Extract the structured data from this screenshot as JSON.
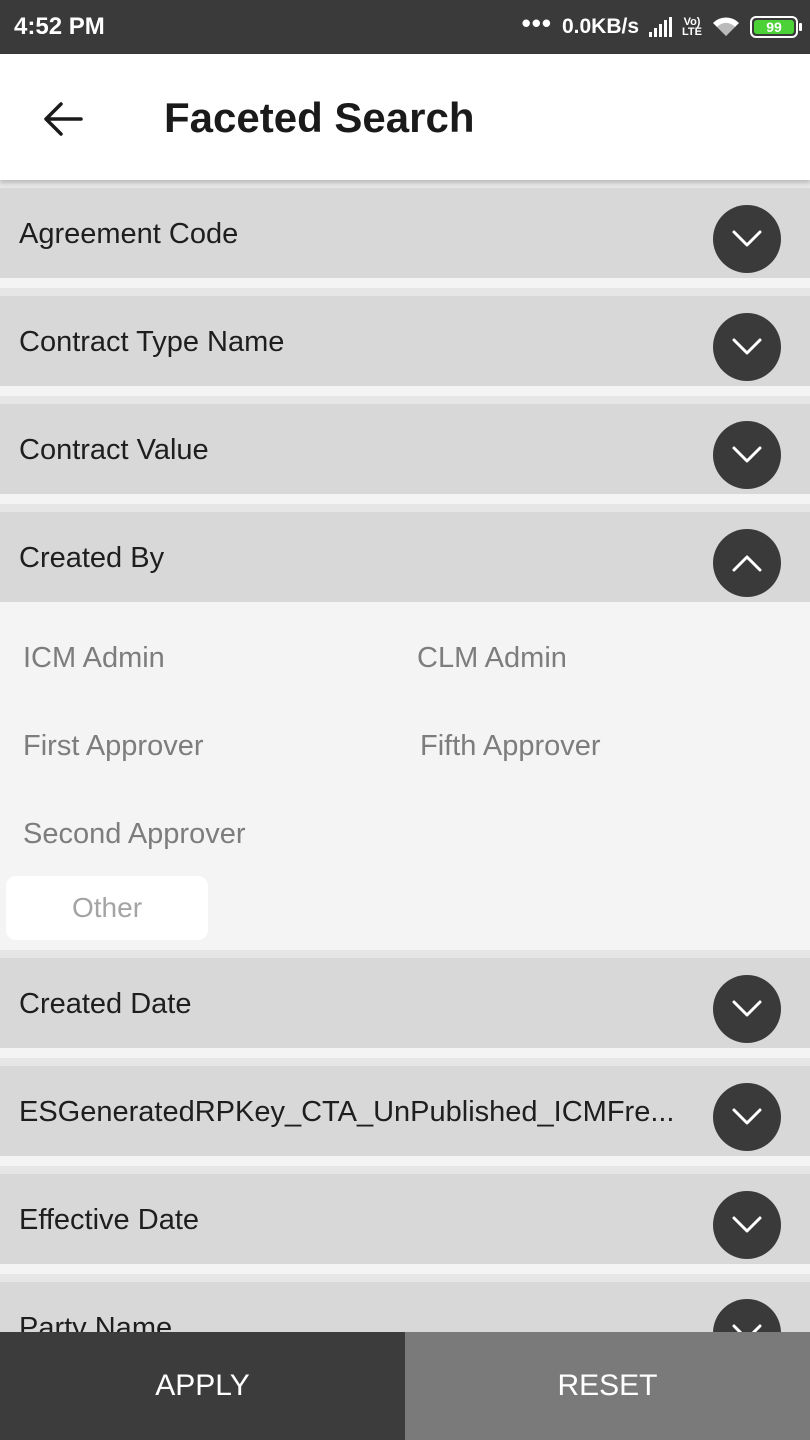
{
  "status_bar": {
    "time": "4:52 PM",
    "dots": "•••",
    "network_speed": "0.0KB/s",
    "volte_line1": "Vo)",
    "volte_line2": "LTE",
    "battery_level": "99",
    "battery_color": "#4cd137"
  },
  "header": {
    "title": "Faceted Search",
    "back_icon": "arrow-left-icon"
  },
  "facets": [
    {
      "label": "Agreement Code",
      "expanded": false
    },
    {
      "label": "Contract Type Name",
      "expanded": false
    },
    {
      "label": "Contract Value",
      "expanded": false
    },
    {
      "label": "Created By",
      "expanded": true
    },
    {
      "label": "Created Date",
      "expanded": false
    },
    {
      "label": "ESGeneratedRPKey_CTA_UnPublished_ICMFre...",
      "expanded": false
    },
    {
      "label": "Effective Date",
      "expanded": false
    },
    {
      "label": "Party Name",
      "expanded": false
    }
  ],
  "created_by_options": [
    "ICM Admin",
    "CLM Admin",
    "First Approver",
    "Fifth Approver",
    "Second Approver"
  ],
  "created_by_other_label": "Other",
  "footer": {
    "apply_label": "APPLY",
    "reset_label": "RESET"
  },
  "colors": {
    "dark": "#3a3a3a",
    "facet_bg": "#d8d8d8",
    "apply_bg": "#3c3c3c",
    "reset_bg": "#7a7a7a"
  }
}
